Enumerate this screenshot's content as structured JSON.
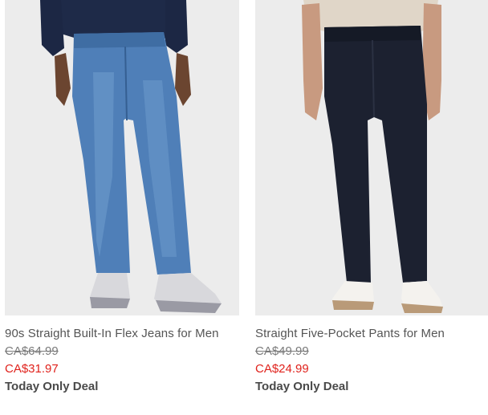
{
  "colors": {
    "sale_price": "#e0221c",
    "photo_background": "#ececec"
  },
  "products": [
    {
      "image": "product-photo-blue-jeans",
      "title": "90s Straight Built-In Flex Jeans for Men",
      "original_price": "CA$64.99",
      "sale_price": "CA$31.97",
      "deal_label": "Today Only Deal"
    },
    {
      "image": "product-photo-dark-pants",
      "title": "Straight Five-Pocket Pants for Men",
      "original_price": "CA$49.99",
      "sale_price": "CA$24.99",
      "deal_label": "Today Only Deal"
    }
  ]
}
